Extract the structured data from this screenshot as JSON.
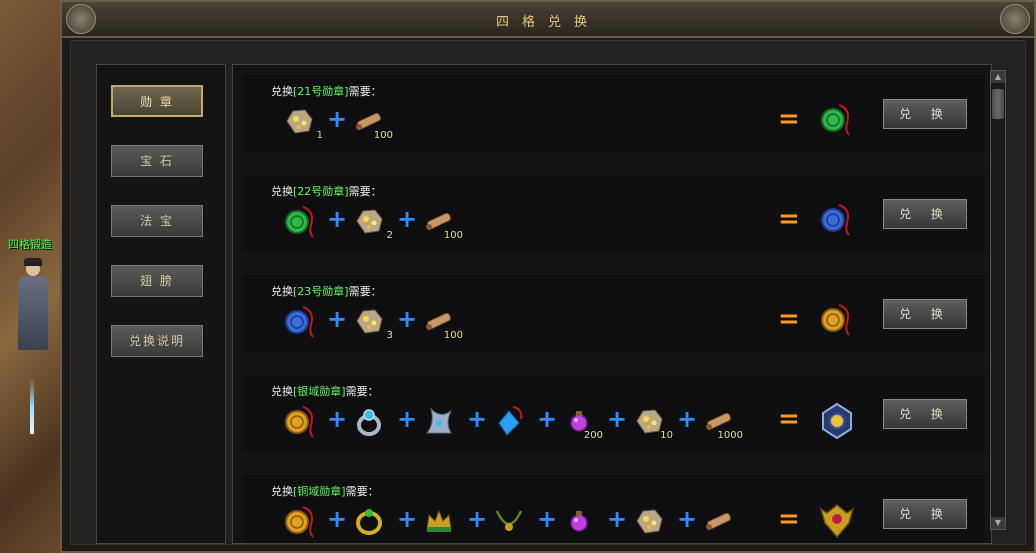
{
  "window": {
    "title": "四格兑换"
  },
  "npc": {
    "name": "四格锻造"
  },
  "sidebar": {
    "items": [
      {
        "label": "勋 章",
        "active": true
      },
      {
        "label": "宝 石",
        "active": false
      },
      {
        "label": "法 宝",
        "active": false
      },
      {
        "label": "翅 膀",
        "active": false
      },
      {
        "label": "兑换说明",
        "active": false
      }
    ]
  },
  "exchange": {
    "button_label": "兑 换",
    "colors": {
      "plus": "#2f8cff",
      "equals": "#ff9a1e",
      "medal_name": "#5cff5c"
    },
    "rows": [
      {
        "prefix": "兑换",
        "medal_name": "[21号勋章]",
        "suffix": "需要：",
        "ingredients": [
          {
            "icon": "gold-ore-icon",
            "count": "1"
          },
          {
            "icon": "scroll-icon",
            "count": "100"
          }
        ],
        "result_icon": "green-medal-icon"
      },
      {
        "prefix": "兑换",
        "medal_name": "[22号勋章]",
        "suffix": "需要：",
        "ingredients": [
          {
            "icon": "green-medal-icon",
            "count": ""
          },
          {
            "icon": "gold-ore-icon",
            "count": "2"
          },
          {
            "icon": "scroll-icon",
            "count": "100"
          }
        ],
        "result_icon": "blue-medal-icon"
      },
      {
        "prefix": "兑换",
        "medal_name": "[23号勋章]",
        "suffix": "需要：",
        "ingredients": [
          {
            "icon": "blue-medal-icon",
            "count": ""
          },
          {
            "icon": "gold-ore-icon",
            "count": "3"
          },
          {
            "icon": "scroll-icon",
            "count": "100"
          }
        ],
        "result_icon": "gold-medal-icon"
      },
      {
        "prefix": "兑换",
        "medal_name": "[银域勋章]",
        "suffix": "需要：",
        "ingredients": [
          {
            "icon": "gold-medal-icon",
            "count": ""
          },
          {
            "icon": "silver-ring-icon",
            "count": ""
          },
          {
            "icon": "silver-claw-icon",
            "count": ""
          },
          {
            "icon": "blue-gem-icon",
            "count": ""
          },
          {
            "icon": "purple-orb-icon",
            "count": "200"
          },
          {
            "icon": "gold-ore-icon",
            "count": "10"
          },
          {
            "icon": "scroll-icon",
            "count": "1000"
          }
        ],
        "result_icon": "silver-domain-medal-icon"
      },
      {
        "prefix": "兑换",
        "medal_name": "[铜域勋章]",
        "suffix": "需要：",
        "ingredients": [
          {
            "icon": "gold-medal-icon",
            "count": ""
          },
          {
            "icon": "gold-ring-icon",
            "count": ""
          },
          {
            "icon": "green-crown-icon",
            "count": ""
          },
          {
            "icon": "green-necklace-icon",
            "count": ""
          },
          {
            "icon": "purple-orb-icon",
            "count": ""
          },
          {
            "icon": "gold-ore-icon",
            "count": ""
          },
          {
            "icon": "scroll-icon",
            "count": ""
          }
        ],
        "result_icon": "bronze-domain-medal-icon"
      }
    ]
  }
}
